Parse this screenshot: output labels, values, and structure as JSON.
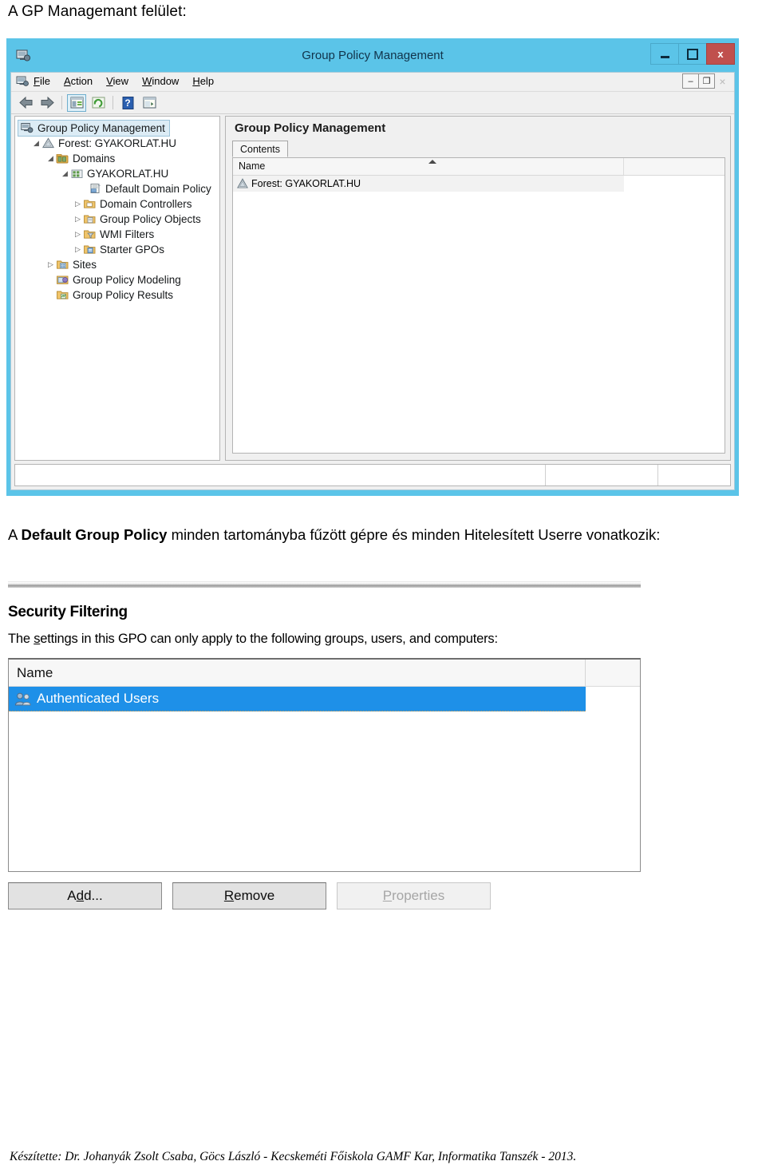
{
  "document": {
    "heading": "A GP Managemant felület:",
    "paragraph_prefix": "A ",
    "paragraph_bold": "Default Group Policy",
    "paragraph_suffix": " minden tartományba fűzött gépre és minden Hitelesített Userre vonatkozik:",
    "footer": "Készítette: Dr. Johanyák Zsolt Csaba, Göcs László - Kecskeméti Főiskola GAMF Kar, Informatika Tanszék - 2013."
  },
  "gpmc": {
    "title": "Group Policy Management",
    "window_controls": {
      "minimize": "minimize-label",
      "maximize": "maximize-label",
      "close": "x"
    },
    "mdi_controls": {
      "minimize": "–",
      "restore": "❐",
      "close": "×"
    },
    "menu": [
      {
        "prefix": "",
        "accel": "F",
        "rest": "ile"
      },
      {
        "prefix": "",
        "accel": "A",
        "rest": "ction"
      },
      {
        "prefix": "",
        "accel": "V",
        "rest": "iew"
      },
      {
        "prefix": "",
        "accel": "W",
        "rest": "indow"
      },
      {
        "prefix": "",
        "accel": "H",
        "rest": "elp"
      }
    ],
    "toolbar": [
      {
        "name": "back-icon"
      },
      {
        "name": "forward-icon"
      },
      {
        "name": "show-hide-console-tree-icon"
      },
      {
        "name": "refresh-icon"
      },
      {
        "name": "help-icon"
      },
      {
        "name": "show-action-pane-icon"
      }
    ],
    "tree": [
      {
        "label": "Group Policy Management",
        "indent": 0,
        "twisty": "",
        "icon": "console-root-icon",
        "selected": true
      },
      {
        "label": "Forest: GYAKORLAT.HU",
        "indent": 1,
        "twisty": "expanded",
        "icon": "forest-icon",
        "selected": false
      },
      {
        "label": "Domains",
        "indent": 2,
        "twisty": "expanded",
        "icon": "domains-icon",
        "selected": false
      },
      {
        "label": "GYAKORLAT.HU",
        "indent": 3,
        "twisty": "expanded",
        "icon": "domain-icon",
        "selected": false
      },
      {
        "label": "Default Domain Policy",
        "indent": 5,
        "twisty": "",
        "icon": "gpo-link-icon",
        "selected": false
      },
      {
        "label": "Domain Controllers",
        "indent": 4,
        "twisty": "collapsed",
        "icon": "ou-folder-icon",
        "selected": false
      },
      {
        "label": "Group Policy Objects",
        "indent": 4,
        "twisty": "collapsed",
        "icon": "gpo-folder-icon",
        "selected": false
      },
      {
        "label": "WMI Filters",
        "indent": 4,
        "twisty": "collapsed",
        "icon": "wmi-filter-folder-icon",
        "selected": false
      },
      {
        "label": "Starter GPOs",
        "indent": 4,
        "twisty": "collapsed",
        "icon": "starter-gpo-folder-icon",
        "selected": false
      },
      {
        "label": "Sites",
        "indent": 2,
        "twisty": "collapsed",
        "icon": "sites-folder-icon",
        "selected": false
      },
      {
        "label": "Group Policy Modeling",
        "indent": 3,
        "twisty": "",
        "icon": "gp-modeling-icon",
        "selected": false
      },
      {
        "label": "Group Policy Results",
        "indent": 3,
        "twisty": "",
        "icon": "gp-results-icon",
        "selected": false
      }
    ],
    "right_pane": {
      "title": "Group Policy Management",
      "tab_label": "Contents",
      "columns": [
        "Name",
        ""
      ],
      "rows": [
        {
          "name": "Forest: GYAKORLAT.HU",
          "icon": "forest-icon"
        }
      ]
    },
    "statusbar": {
      "main": "",
      "segment2": "",
      "segment3": ""
    }
  },
  "security_filtering": {
    "heading": "Security Filtering",
    "description_pre": "The ",
    "description_accel1": "s",
    "description_mid": "ettings in this GPO can only apply to the followin",
    "description_accel2": "g",
    "description_post": " groups, users, and computers:",
    "columns": [
      "Name",
      ""
    ],
    "rows": [
      {
        "name": "Authenticated Users",
        "icon": "users-group-icon",
        "selected": true
      }
    ],
    "buttons": [
      {
        "pre": "A",
        "accel": "d",
        "post": "d...",
        "name": "add-button",
        "disabled": false
      },
      {
        "pre": "",
        "accel": "R",
        "post": "emove",
        "name": "remove-button",
        "disabled": false
      },
      {
        "pre": "",
        "accel": "P",
        "post": "roperties",
        "name": "properties-button",
        "disabled": true
      }
    ]
  },
  "colors": {
    "titlebar": "#5bc4e8",
    "close_button": "#c0504d",
    "selection_blue": "#1e90e8",
    "tree_selection": "#dcecf5"
  }
}
